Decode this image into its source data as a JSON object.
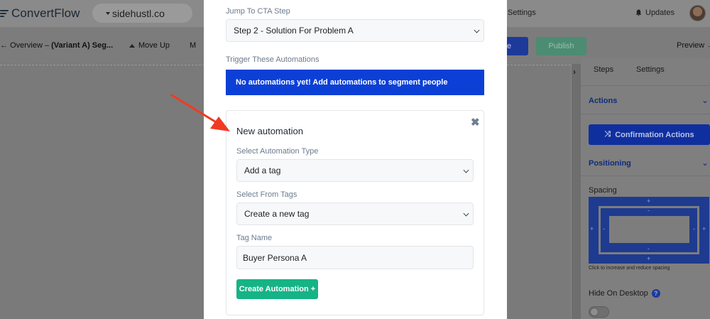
{
  "topbar": {
    "app_name": "ConvertFlow",
    "site": "sidehustl.co",
    "settings": "Settings",
    "updates": "Updates"
  },
  "subbar": {
    "breadcrumb_prefix": "Overview – ",
    "breadcrumb_bold": "(Variant A) Seg...",
    "move_up": "Move Up",
    "move_down_partial": "M",
    "save_partial": "e",
    "publish": "Publish",
    "preview": "Preview"
  },
  "right_panel": {
    "tabs": [
      "Steps",
      "Settings"
    ],
    "actions_label": "Actions",
    "confirmation_actions": "Confirmation Actions",
    "positioning_label": "Positioning",
    "spacing_label": "Spacing",
    "spacing_hint": "Click to increase and reduce spacing",
    "hide_on_desktop": "Hide On Desktop",
    "help_icon_glyph": "?",
    "plus": "+",
    "minus": "-"
  },
  "modal": {
    "jump_label": "Jump To CTA Step",
    "jump_value": "Step 2 - Solution For Problem A",
    "trigger_label": "Trigger These Automations",
    "empty_banner": "No automations yet! Add automations to segment people",
    "new_automation": {
      "title": "New automation",
      "close_glyph": "✖",
      "type_label": "Select Automation Type",
      "type_value": "Add a tag",
      "tags_label": "Select From Tags",
      "tags_value": "Create a new tag",
      "tag_name_label": "Tag Name",
      "tag_name_value": "Buyer Persona A",
      "create_button": "Create Automation +"
    }
  },
  "colors": {
    "primary_blue": "#0c3fd6",
    "create_green": "#16b386",
    "annotation_red": "#f03a24"
  }
}
